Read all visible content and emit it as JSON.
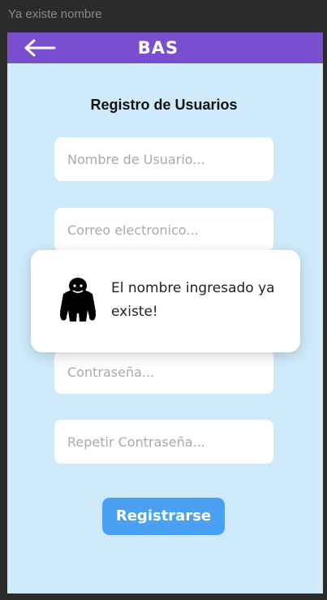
{
  "window": {
    "title": "Ya existe nombre"
  },
  "appbar": {
    "back_icon": "arrow-left-icon",
    "title": "BAS",
    "color": "#7a4fcf"
  },
  "form": {
    "title": "Registro de Usuarios",
    "fields": {
      "username_placeholder": "Nombre de Usuario...",
      "email_placeholder": "Correo electronico...",
      "password_placeholder": "Contraseña...",
      "repeat_password_placeholder": "Repetir Contraseña..."
    },
    "submit_label": "Registrarse",
    "submit_color": "#4aa1f2"
  },
  "toast": {
    "icon": "gorilla-icon",
    "message": "El nombre ingresado ya existe!"
  },
  "colors": {
    "background": "#cfebfb",
    "frame": "#2b2b2b"
  }
}
